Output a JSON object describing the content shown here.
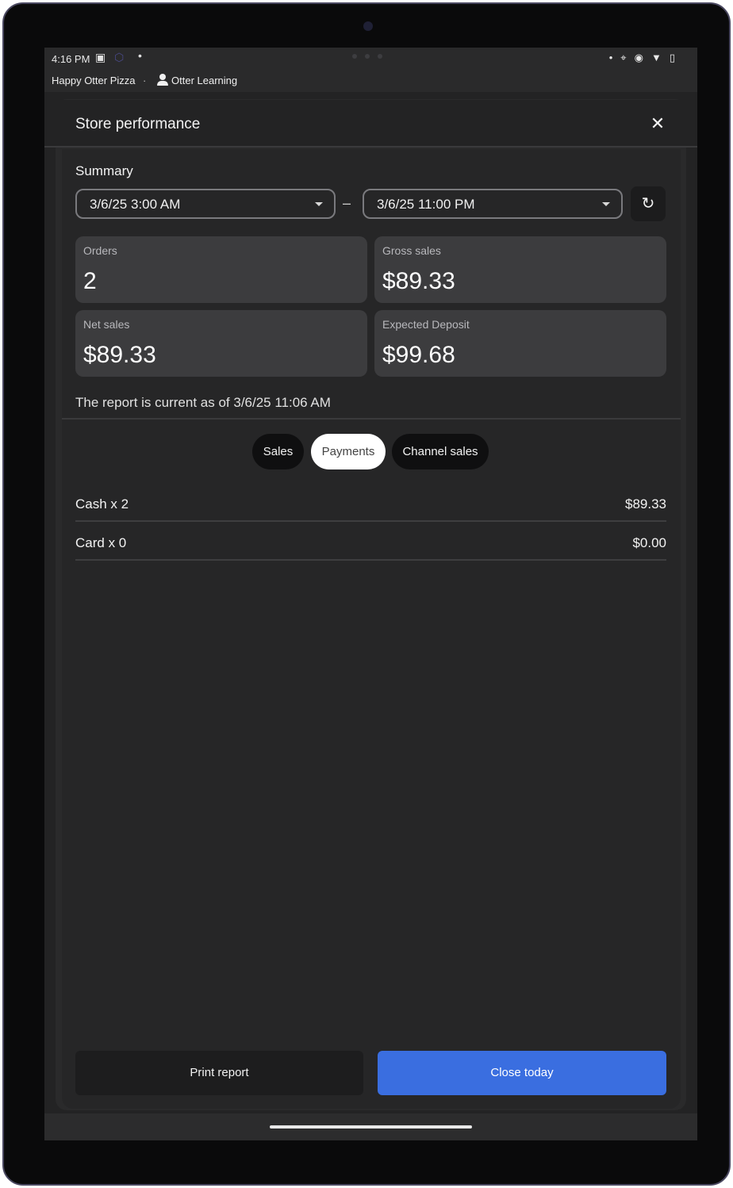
{
  "status_bar": {
    "time": "4:16 PM"
  },
  "app_bar": {
    "store_name": "Happy Otter Pizza",
    "separator": "·",
    "user_name": "Otter Learning"
  },
  "modal": {
    "title": "Store performance",
    "close_glyph": "✕"
  },
  "summary": {
    "heading": "Summary",
    "start_date": "3/6/25 3:00 AM",
    "end_date": "3/6/25 11:00 PM",
    "range_separator": "–",
    "refresh_glyph": "↻",
    "cards": {
      "orders": {
        "label": "Orders",
        "value": "2"
      },
      "gross_sales": {
        "label": "Gross sales",
        "value": "$89.33"
      },
      "net_sales": {
        "label": "Net sales",
        "value": "$89.33"
      },
      "expected_deposit": {
        "label": "Expected Deposit",
        "value": "$99.68"
      }
    },
    "as_of": "The report is current as of 3/6/25 11:06 AM"
  },
  "tabs": [
    {
      "label": "Sales",
      "selected": false
    },
    {
      "label": "Payments",
      "selected": true
    },
    {
      "label": "Channel sales",
      "selected": false
    }
  ],
  "payments": [
    {
      "label": "Cash x 2",
      "amount": "$89.33"
    },
    {
      "label": "Card x 0",
      "amount": "$0.00"
    }
  ],
  "actions": {
    "print_label": "Print report",
    "close_label": "Close today"
  },
  "colors": {
    "accent": "#3a6ee0",
    "background": "#232324",
    "card": "#3c3c3e"
  }
}
